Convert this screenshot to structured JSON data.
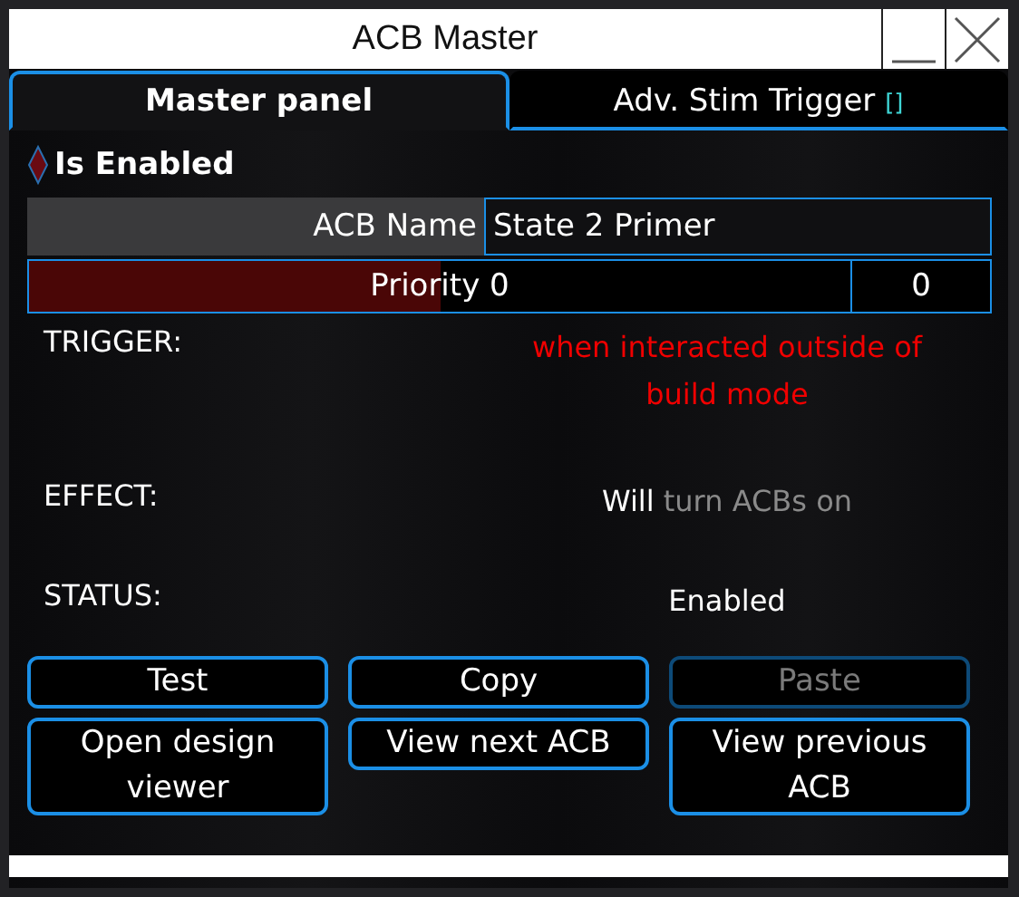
{
  "window": {
    "title": "ACB Master"
  },
  "tabs": [
    {
      "label": "Master panel",
      "selected": true
    },
    {
      "label": "Adv. Stim Trigger",
      "suffix": "[]",
      "selected": false
    }
  ],
  "enabled": {
    "label": "Is Enabled",
    "checked": true
  },
  "name_field": {
    "label": "ACB Name",
    "value": "State 2 Primer"
  },
  "priority": {
    "label": "Priority 0",
    "level": 0.5,
    "value": "0"
  },
  "info": [
    {
      "label": "TRIGGER:",
      "kind": "alert",
      "text": "when interacted outside of build mode"
    },
    {
      "label": "EFFECT:",
      "kind": "split",
      "prefix": "Will",
      "text": "turn ACBs on"
    },
    {
      "label": "STATUS:",
      "kind": "plain",
      "text": "Enabled"
    }
  ],
  "buttons": [
    {
      "label": "Test",
      "disabled": false
    },
    {
      "label": "Copy",
      "disabled": false
    },
    {
      "label": "Paste",
      "disabled": true
    },
    {
      "label": "Open design viewer",
      "disabled": false
    },
    {
      "label": "View next ACB",
      "disabled": false
    },
    {
      "label": "View previous ACB",
      "disabled": false
    }
  ]
}
